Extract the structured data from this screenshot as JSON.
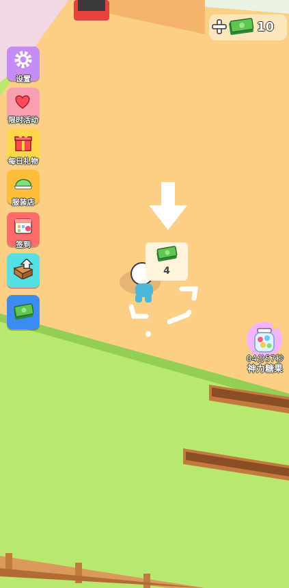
{
  "currency": {
    "amount": "10",
    "plus_icon": "plus-icon",
    "money_icon": "cash-icon"
  },
  "menu": [
    {
      "key": "settings",
      "label": "设置",
      "icon": "gear-icon",
      "color": "#c48cf4"
    },
    {
      "key": "limited",
      "label": "限时活动",
      "icon": "hearts-icon",
      "color": "#f7a0b2"
    },
    {
      "key": "daily_gift",
      "label": "每日礼物",
      "icon": "gift-icon",
      "color": "#ffd64a"
    },
    {
      "key": "clothing",
      "label": "服装店",
      "icon": "cap-icon",
      "color": "#ffbe3a"
    },
    {
      "key": "signin",
      "label": "签到",
      "icon": "calendar-icon",
      "color": "#ff6a6a"
    },
    {
      "key": "upgrade",
      "label": "",
      "icon": "box-upgrade-icon",
      "color": "#55e0e6"
    },
    {
      "key": "cash",
      "label": "",
      "icon": "cash-icon",
      "color": "#3b8cf0"
    }
  ],
  "pad": {
    "cost": "4",
    "icon": "cash-icon"
  },
  "candy": {
    "timer": "04分57秒",
    "name": "神力糖果",
    "icon": "candy-jar-icon"
  }
}
